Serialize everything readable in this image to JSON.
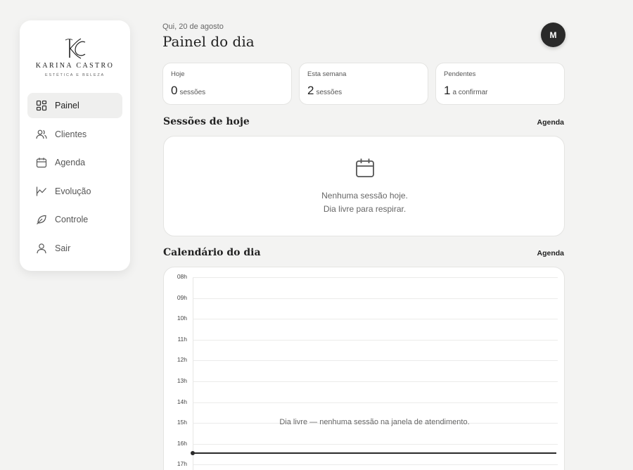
{
  "brand": {
    "name": "KARINA CASTRO",
    "tagline": "ESTÉTICA E BELEZA"
  },
  "sidebar": {
    "items": [
      {
        "label": "Painel",
        "icon": "grid-icon",
        "active": true
      },
      {
        "label": "Clientes",
        "icon": "users-icon",
        "active": false
      },
      {
        "label": "Agenda",
        "icon": "calendar-icon",
        "active": false
      },
      {
        "label": "Evolução",
        "icon": "trend-icon",
        "active": false
      },
      {
        "label": "Controle",
        "icon": "leaf-icon",
        "active": false
      },
      {
        "label": "Sair",
        "icon": "user-icon",
        "active": false
      }
    ]
  },
  "header": {
    "date": "Qui, 20 de agosto",
    "title": "Painel do dia",
    "avatar_initial": "M"
  },
  "stats": [
    {
      "label": "Hoje",
      "value": "0",
      "unit": "sessões"
    },
    {
      "label": "Esta semana",
      "value": "2",
      "unit": "sessões"
    },
    {
      "label": "Pendentes",
      "value": "1",
      "unit": "a confirmar"
    }
  ],
  "today": {
    "title": "Sessões de hoje",
    "link": "Agenda",
    "empty_line1": "Nenhuma sessão hoje.",
    "empty_line2": "Dia livre para respirar."
  },
  "calendar": {
    "title": "Calendário do dia",
    "link": "Agenda",
    "hours": [
      "08h",
      "09h",
      "10h",
      "11h",
      "12h",
      "13h",
      "14h",
      "15h",
      "16h",
      "17h"
    ],
    "free_message": "Dia livre — nenhuma sessão na janela de atendimento."
  },
  "colors": {
    "background": "#f3f3f2",
    "card": "#ffffff",
    "accent": "#2a2a2a",
    "active_nav": "#efefee"
  }
}
